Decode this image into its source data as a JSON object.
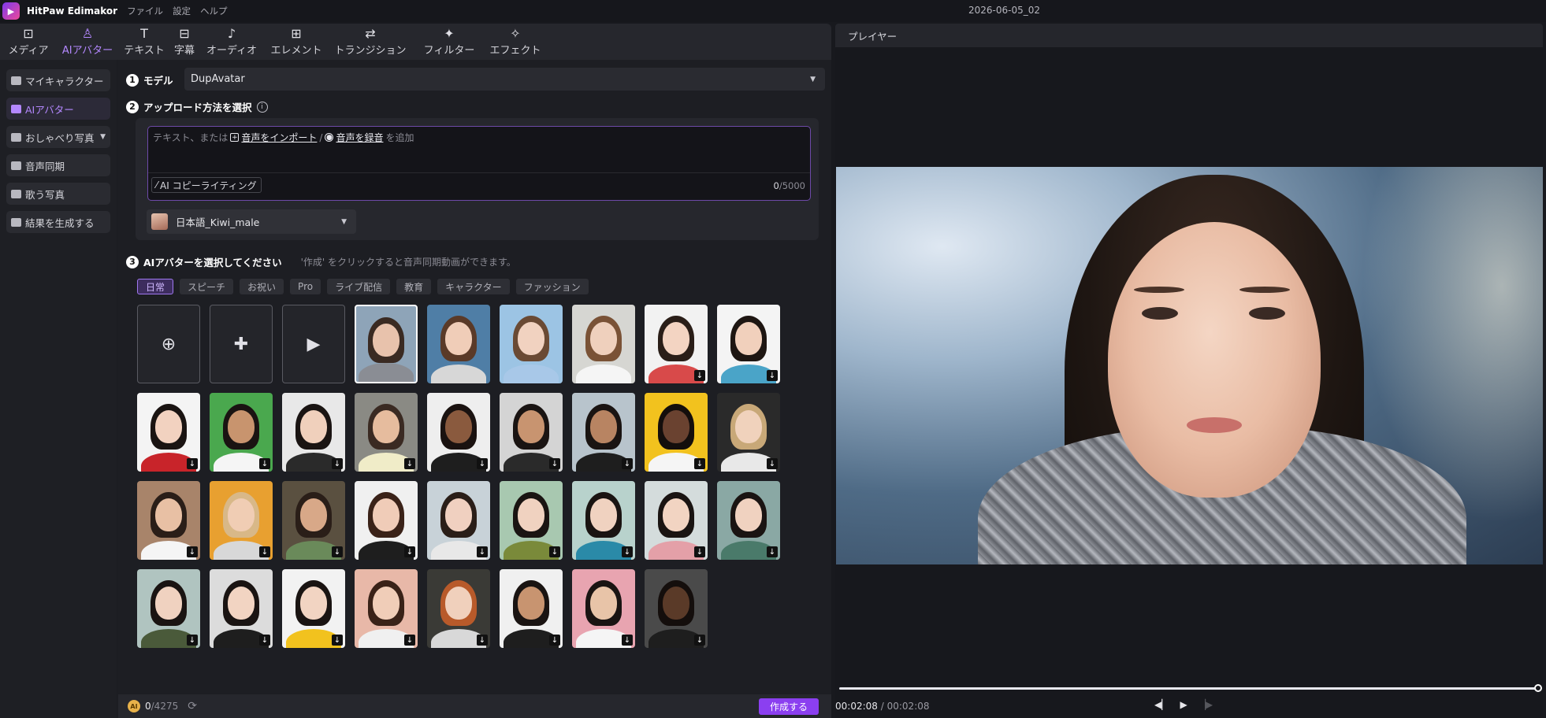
{
  "titlebar": {
    "app_name": "HitPaw Edimakor",
    "menu": [
      "ファイル",
      "設定",
      "ヘルプ"
    ],
    "project_title": "2026-06-05_02"
  },
  "toolbar": {
    "tabs": [
      {
        "label": "メディア",
        "icon": "media-icon"
      },
      {
        "label": "AIアバター",
        "icon": "ai-avatar-icon",
        "active": true
      },
      {
        "label": "テキスト",
        "icon": "text-icon"
      },
      {
        "label": "字幕",
        "icon": "subtitle-icon"
      },
      {
        "label": "オーディオ",
        "icon": "audio-icon"
      },
      {
        "label": "エレメント",
        "icon": "element-icon"
      },
      {
        "label": "トランジション",
        "icon": "transition-icon"
      },
      {
        "label": "フィルター",
        "icon": "filter-icon"
      },
      {
        "label": "エフェクト",
        "icon": "effect-icon"
      }
    ]
  },
  "sidebar": {
    "items": [
      {
        "label": "マイキャラクター"
      },
      {
        "label": "AIアバター",
        "active": true
      },
      {
        "label": "おしゃべり写真",
        "expandable": true
      },
      {
        "label": "音声同期"
      },
      {
        "label": "歌う写真"
      },
      {
        "label": "結果を生成する"
      }
    ]
  },
  "step1": {
    "num": "1",
    "label": "モデル",
    "model_value": "DupAvatar"
  },
  "step2": {
    "num": "2",
    "label": "アップロード方法を選択",
    "hint_prefix": "テキスト、または",
    "import_link": "音声をインポート",
    "separator": "/",
    "record_link": "音声を録音",
    "hint_suffix": "を追加",
    "ai_copy_button": "AI コピーライティング",
    "counter_current": "0",
    "counter_max": "/5000",
    "voice": "日本語_Kiwi_male"
  },
  "step3": {
    "num": "3",
    "label": "AIアバターを選択してください",
    "hint": "'作成' をクリックすると音声同期動画ができます。",
    "categories": [
      "日常",
      "スピーチ",
      "お祝い",
      "Pro",
      "ライブ配信",
      "教育",
      "キャラクター",
      "ファッション"
    ],
    "active_category": "日常"
  },
  "avatars": [
    {
      "kind": "action",
      "icon": "upload-portrait-icon"
    },
    {
      "kind": "action",
      "icon": "ai-generate-avatar-icon"
    },
    {
      "kind": "action",
      "icon": "video-avatar-icon"
    },
    {
      "kind": "photo",
      "skin": "#e8c2ac",
      "hair": "#3a2a22",
      "bg": "#8ea4b8",
      "shirt": "#8a8d94",
      "selected": true,
      "download": false
    },
    {
      "kind": "photo",
      "skin": "#f0cdb8",
      "hair": "#5a3a28",
      "bg": "#4f7ea6",
      "shirt": "#d7d7d7",
      "download": false
    },
    {
      "kind": "photo",
      "skin": "#f1d2c0",
      "hair": "#6a4a34",
      "bg": "#9cc4e4",
      "shirt": "#a8c8e8",
      "download": false
    },
    {
      "kind": "photo",
      "skin": "#efd0bd",
      "hair": "#7a5236",
      "bg": "#d6d6d2",
      "shirt": "#f5f5f5",
      "download": false
    },
    {
      "kind": "photo",
      "skin": "#f3d4c2",
      "hair": "#2a1e18",
      "bg": "#f2f2f2",
      "shirt": "#d84a4a",
      "download": true
    },
    {
      "kind": "photo",
      "skin": "#f1d0bc",
      "hair": "#1e1612",
      "bg": "#f4f4f4",
      "shirt": "#4aa4c8",
      "download": true
    },
    {
      "kind": "photo",
      "skin": "#f2d2c0",
      "hair": "#1a1412",
      "bg": "#f4f4f4",
      "shirt": "#c8242a",
      "download": true
    },
    {
      "kind": "photo",
      "skin": "#c8946e",
      "hair": "#1a1412",
      "bg": "#4aa84e",
      "shirt": "#f5f5f5",
      "download": true
    },
    {
      "kind": "photo",
      "skin": "#f0d0bc",
      "hair": "#1a1412",
      "bg": "#e8e8e8",
      "shirt": "#2a2a2a",
      "download": true
    },
    {
      "kind": "photo",
      "skin": "#e6bc9e",
      "hair": "#3a2a22",
      "bg": "#8a8a84",
      "shirt": "#f0ecc8",
      "download": true
    },
    {
      "kind": "photo",
      "skin": "#8a5a3e",
      "hair": "#1a1210",
      "bg": "#eeeeee",
      "shirt": "#1e1e1e",
      "download": true
    },
    {
      "kind": "photo",
      "skin": "#c89470",
      "hair": "#1a1412",
      "bg": "#d4d4d4",
      "shirt": "#2a2a2a",
      "download": true
    },
    {
      "kind": "photo",
      "skin": "#b88462",
      "hair": "#1a1412",
      "bg": "#b8c4cc",
      "shirt": "#1e1e1e",
      "download": true
    },
    {
      "kind": "photo",
      "skin": "#6a4230",
      "hair": "#140e0c",
      "bg": "#f2c21e",
      "shirt": "#f5f5f5",
      "download": true
    },
    {
      "kind": "photo",
      "skin": "#f0d2bc",
      "hair": "#c8a878",
      "bg": "#2a2a2a",
      "shirt": "#e8e8e8",
      "download": true
    },
    {
      "kind": "photo",
      "skin": "#e8c0a4",
      "hair": "#2a1e18",
      "bg": "#a8846a",
      "shirt": "#f5f5f5",
      "download": true
    },
    {
      "kind": "photo",
      "skin": "#f0cdb4",
      "hair": "#d8b888",
      "bg": "#e8a030",
      "shirt": "#d8d8d8",
      "download": true
    },
    {
      "kind": "photo",
      "skin": "#d8a888",
      "hair": "#2a1e18",
      "bg": "#5a5040",
      "shirt": "#6a8a5a",
      "download": true
    },
    {
      "kind": "photo",
      "skin": "#f0ccb8",
      "hair": "#3a2218",
      "bg": "#f0f0f0",
      "shirt": "#1e1e1e",
      "download": true
    },
    {
      "kind": "photo",
      "skin": "#f0d0c0",
      "hair": "#2a1e18",
      "bg": "#c8d2d8",
      "shirt": "#e8e8e8",
      "download": true
    },
    {
      "kind": "photo",
      "skin": "#f0d2c0",
      "hair": "#1a1412",
      "bg": "#a8c8b0",
      "shirt": "#7a8a3a",
      "download": true
    },
    {
      "kind": "photo",
      "skin": "#f0d2c0",
      "hair": "#1a1412",
      "bg": "#b8d2cc",
      "shirt": "#2a8aa8",
      "download": true
    },
    {
      "kind": "photo",
      "skin": "#f2d4c2",
      "hair": "#1a1412",
      "bg": "#d4dcdc",
      "shirt": "#e4a0a8",
      "download": true
    },
    {
      "kind": "photo",
      "skin": "#f0d2c0",
      "hair": "#1a1412",
      "bg": "#8aa8a4",
      "shirt": "#4a7a6a",
      "download": true
    },
    {
      "kind": "photo",
      "skin": "#f0d2c0",
      "hair": "#1a1412",
      "bg": "#b0c4c0",
      "shirt": "#4a5a3a",
      "download": true
    },
    {
      "kind": "photo",
      "skin": "#f2d4c2",
      "hair": "#1a1412",
      "bg": "#dcdcdc",
      "shirt": "#1e1e1e",
      "download": true
    },
    {
      "kind": "photo",
      "skin": "#f2d4c2",
      "hair": "#1a1412",
      "bg": "#f2f2f2",
      "shirt": "#f2c21e",
      "download": true
    },
    {
      "kind": "photo",
      "skin": "#f0cdb8",
      "hair": "#3a2218",
      "bg": "#e8b8a8",
      "shirt": "#f0f0f0",
      "download": true
    },
    {
      "kind": "photo",
      "skin": "#f0d0bc",
      "hair": "#b85a2a",
      "bg": "#3a3a36",
      "shirt": "#d8d8d8",
      "download": true
    },
    {
      "kind": "photo",
      "skin": "#c89470",
      "hair": "#1a1412",
      "bg": "#f0f0f0",
      "shirt": "#1e1e1e",
      "download": true
    },
    {
      "kind": "photo",
      "skin": "#e8c4a8",
      "hair": "#1a1412",
      "bg": "#e8a4b0",
      "shirt": "#f5f5f5",
      "download": true
    },
    {
      "kind": "photo",
      "skin": "#5a3a28",
      "hair": "#140e0c",
      "bg": "#4a4a4a",
      "shirt": "#1e1e1e",
      "download": true
    }
  ],
  "bottom": {
    "credits_used": "0",
    "credits_total": "/4275",
    "create_button": "作成する"
  },
  "player": {
    "title": "プレイヤー",
    "current_time": "00:02:08",
    "time_separator": "/",
    "total_time": "00:02:08",
    "progress_fraction": 1.0
  }
}
